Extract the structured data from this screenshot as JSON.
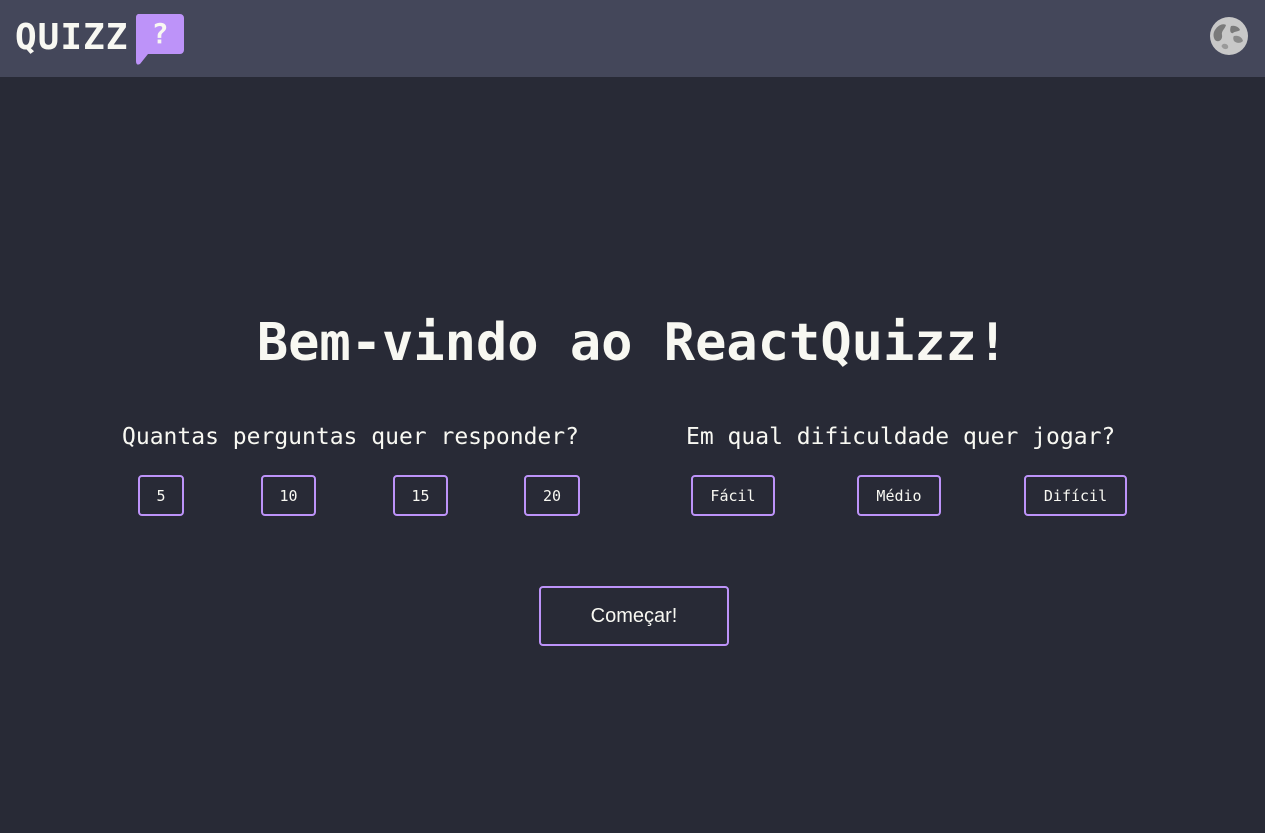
{
  "header": {
    "logo_text": "QUIZZ",
    "logo_symbol": "?",
    "theme_icon": "moon-icon"
  },
  "main": {
    "title": "Bem-vindo ao ReactQuizz!",
    "questions_prompt": "Quantas perguntas quer responder?",
    "question_counts": [
      "5",
      "10",
      "15",
      "20"
    ],
    "difficulty_prompt": "Em qual dificuldade quer jogar?",
    "difficulties": [
      "Fácil",
      "Médio",
      "Difícil"
    ],
    "start_label": "Começar!"
  },
  "colors": {
    "background": "#282a36",
    "header": "#44475a",
    "accent": "#bd93f9",
    "text": "#f8f8f2"
  }
}
